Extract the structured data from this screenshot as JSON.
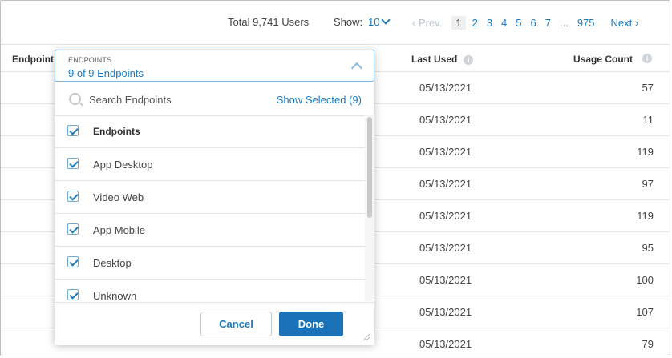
{
  "pagination": {
    "total_text": "Total 9,741 Users",
    "show_label": "Show:",
    "show_value": "10",
    "prev_label": "Prev.",
    "pages": [
      "1",
      "2",
      "3",
      "4",
      "5",
      "6",
      "7"
    ],
    "active_page": "1",
    "ellipsis": "...",
    "last_page": "975",
    "next_label": "Next"
  },
  "table": {
    "headers": {
      "endpoint": "Endpoint",
      "last_used": "Last Used",
      "usage_count": "Usage Count"
    },
    "rows": [
      {
        "last_used": "05/13/2021",
        "usage_count": "57"
      },
      {
        "last_used": "05/13/2021",
        "usage_count": "11"
      },
      {
        "last_used": "05/13/2021",
        "usage_count": "119"
      },
      {
        "last_used": "05/13/2021",
        "usage_count": "97"
      },
      {
        "last_used": "05/13/2021",
        "usage_count": "119"
      },
      {
        "last_used": "05/13/2021",
        "usage_count": "95"
      },
      {
        "last_used": "05/13/2021",
        "usage_count": "100"
      },
      {
        "last_used": "05/13/2021",
        "usage_count": "107"
      },
      {
        "last_used": "05/13/2021",
        "usage_count": "79"
      }
    ]
  },
  "dropdown": {
    "field_label": "ENDPOINTS",
    "field_value": "9 of 9 Endpoints",
    "search_placeholder": "Search Endpoints",
    "show_selected": "Show Selected (9)",
    "items": [
      {
        "label": "Endpoints",
        "checked": true
      },
      {
        "label": "App Desktop",
        "checked": true
      },
      {
        "label": "Video Web",
        "checked": true
      },
      {
        "label": "App Mobile",
        "checked": true
      },
      {
        "label": "Desktop",
        "checked": true
      },
      {
        "label": "Unknown",
        "checked": true
      }
    ],
    "cancel_label": "Cancel",
    "done_label": "Done"
  },
  "colors": {
    "accent": "#1a7bbf",
    "done_button": "#1a73b8",
    "border": "#e3e3e3"
  }
}
